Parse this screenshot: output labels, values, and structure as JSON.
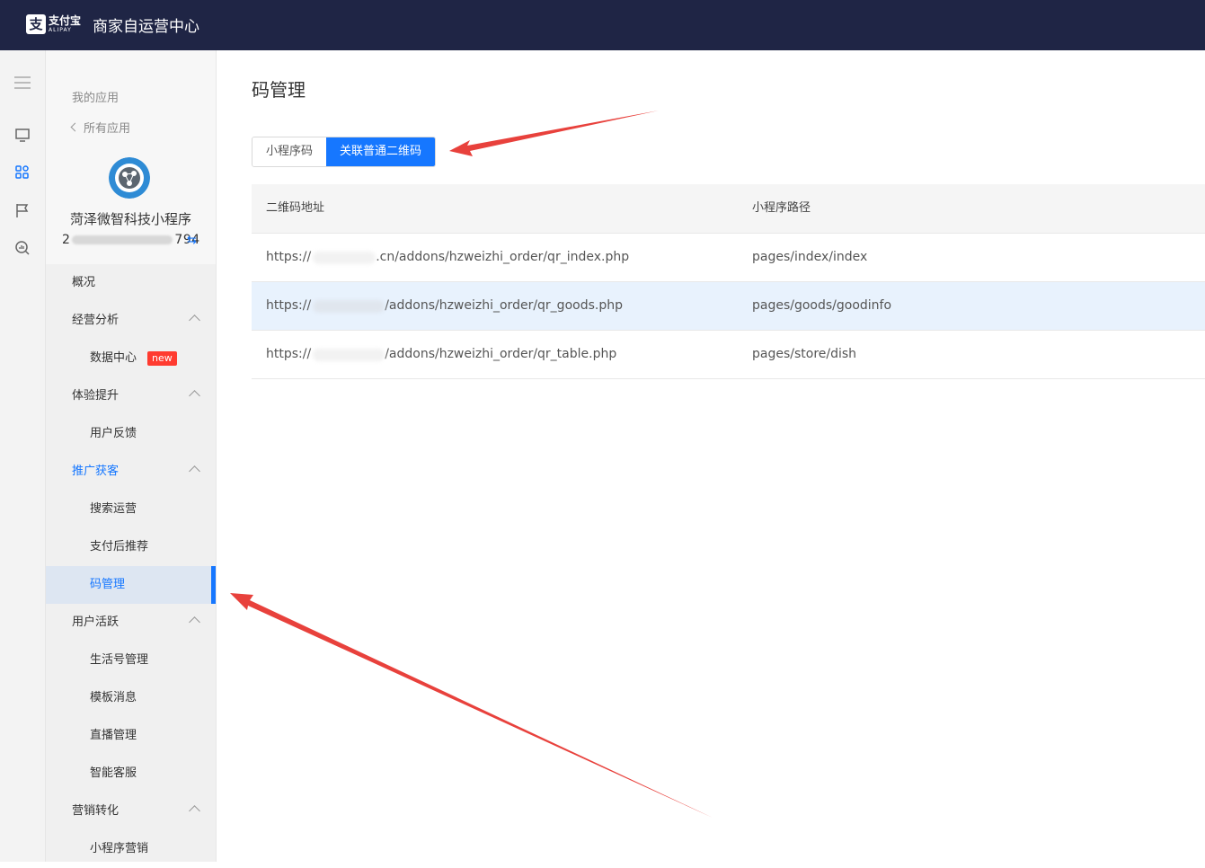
{
  "header": {
    "logo_cn": "支付宝",
    "logo_en": "ALIPAY",
    "title": "商家自运营中心"
  },
  "iconbar": {
    "items": [
      {
        "icon": "menu-icon"
      },
      {
        "icon": "monitor-icon"
      },
      {
        "icon": "apps-grid-icon",
        "active": true
      },
      {
        "icon": "flag-icon"
      },
      {
        "icon": "analytics-search-icon"
      }
    ]
  },
  "sidebar": {
    "my_apps": "我的应用",
    "all_apps": "所有应用",
    "app_name": "菏泽微智科技小程序",
    "app_id_prefix": "2",
    "app_id_suffix": "794",
    "nav": [
      {
        "label": "概况",
        "type": "group"
      },
      {
        "label": "经营分析",
        "type": "group",
        "expanded": true
      },
      {
        "label": "数据中心",
        "type": "child",
        "badge": "new"
      },
      {
        "label": "体验提升",
        "type": "group",
        "expanded": true
      },
      {
        "label": "用户反馈",
        "type": "child"
      },
      {
        "label": "推广获客",
        "type": "group",
        "expanded": true,
        "highlight": true
      },
      {
        "label": "搜索运营",
        "type": "child"
      },
      {
        "label": "支付后推荐",
        "type": "child"
      },
      {
        "label": "码管理",
        "type": "child",
        "active": true
      },
      {
        "label": "用户活跃",
        "type": "group",
        "expanded": true
      },
      {
        "label": "生活号管理",
        "type": "child"
      },
      {
        "label": "模板消息",
        "type": "child"
      },
      {
        "label": "直播管理",
        "type": "child"
      },
      {
        "label": "智能客服",
        "type": "child"
      },
      {
        "label": "营销转化",
        "type": "group",
        "expanded": true
      },
      {
        "label": "小程序营销",
        "type": "child"
      }
    ]
  },
  "main": {
    "title": "码管理",
    "tabs": [
      {
        "label": "小程序码",
        "active": false
      },
      {
        "label": "关联普通二维码",
        "active": true
      }
    ],
    "table": {
      "headers": [
        "二维码地址",
        "小程序路径"
      ],
      "rows": [
        {
          "url_prefix": "https://",
          "url_suffix": ".cn/addons/hzweizhi_order/qr_index.php",
          "path": "pages/index/index"
        },
        {
          "url_prefix": "https://",
          "url_suffix": "/addons/hzweizhi_order/qr_goods.php",
          "path": "pages/goods/goodinfo",
          "highlighted": true
        },
        {
          "url_prefix": "https://",
          "url_suffix": "/addons/hzweizhi_order/qr_table.php",
          "path": "pages/store/dish"
        }
      ]
    }
  },
  "colors": {
    "topbar": "#1f2545",
    "primary": "#1677ff",
    "badge": "#ff3b30",
    "annotation_arrow": "#e8413c"
  }
}
